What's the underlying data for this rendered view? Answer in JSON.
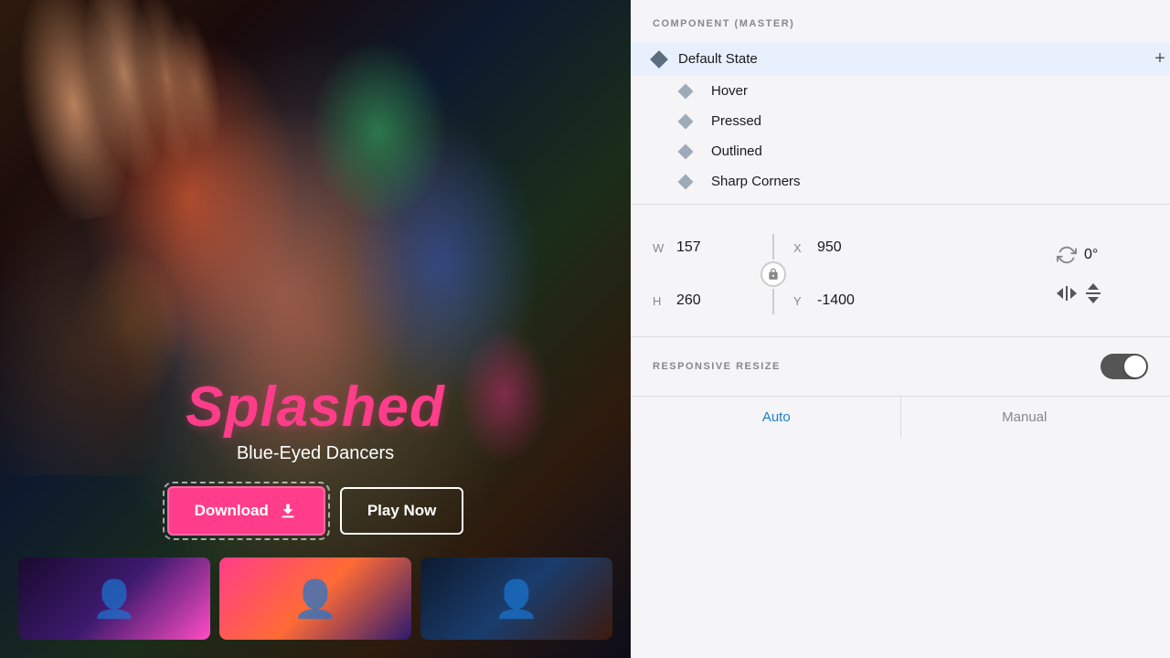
{
  "left": {
    "title": "Splashed",
    "subtitle": "Blue-Eyed Dancers",
    "btn_download": "Download",
    "btn_playnow": "Play Now",
    "download_icon": "⬇"
  },
  "right": {
    "component_label": "COMPONENT (MASTER)",
    "states": {
      "default": "Default State",
      "hover": "Hover",
      "pressed": "Pressed",
      "outlined": "Outlined",
      "sharp_corners": "Sharp Corners"
    },
    "add_btn": "+",
    "dimensions": {
      "w_label": "W",
      "w_value": "157",
      "h_label": "H",
      "h_value": "260",
      "x_label": "X",
      "x_value": "950",
      "y_label": "Y",
      "y_value": "-1400",
      "rotation": "0°"
    },
    "responsive_label": "RESPONSIVE RESIZE",
    "auto_label": "Auto",
    "manual_label": "Manual"
  }
}
